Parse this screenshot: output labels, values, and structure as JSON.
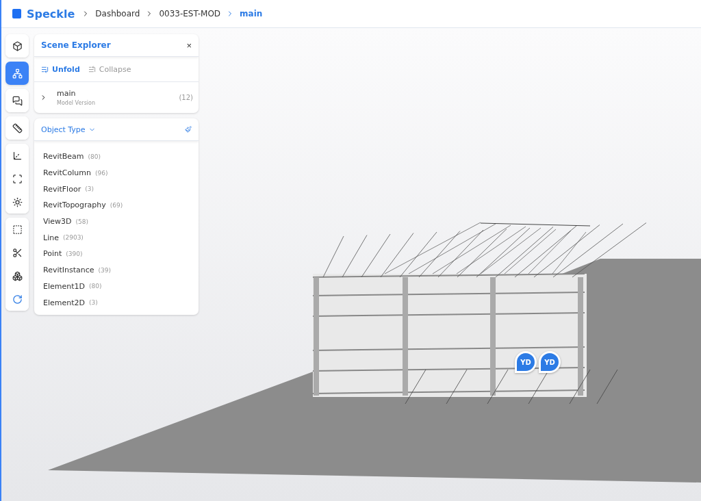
{
  "header": {
    "brand": "Speckle",
    "breadcrumbs": [
      {
        "label": "Dashboard",
        "current": false
      },
      {
        "label": "0033-EST-MOD",
        "current": false
      },
      {
        "label": "main",
        "current": true
      }
    ]
  },
  "toolbar": {
    "groups": [
      {
        "tools": [
          {
            "selected": false
          }
        ]
      },
      {
        "tools": [
          {
            "selected": true
          }
        ]
      },
      {
        "tools": [
          {
            "selected": false
          }
        ]
      },
      {
        "tools": [
          {
            "selected": false
          }
        ]
      },
      {
        "tools": [
          {
            "selected": false
          },
          {
            "selected": false
          },
          {
            "selected": false
          }
        ]
      },
      {
        "tools": [
          {
            "selected": false
          },
          {
            "selected": false
          },
          {
            "selected": false
          },
          {
            "selected": false
          }
        ]
      }
    ]
  },
  "scene_explorer": {
    "title": "Scene Explorer",
    "close": "×",
    "actions": [
      {
        "label": "Unfold",
        "disabled": false
      },
      {
        "label": "Collapse",
        "disabled": true
      }
    ],
    "model": {
      "name": "main",
      "subtitle": "Model Version",
      "count": "(12)",
      "expanded": false
    }
  },
  "filter": {
    "title": "Object Type",
    "items": [
      {
        "name": "RevitBeam",
        "count": "(80)"
      },
      {
        "name": "RevitColumn",
        "count": "(96)"
      },
      {
        "name": "RevitFloor",
        "count": "(3)"
      },
      {
        "name": "RevitTopography",
        "count": "(69)"
      },
      {
        "name": "View3D",
        "count": "(58)"
      },
      {
        "name": "Line",
        "count": "(2903)"
      },
      {
        "name": "Point",
        "count": "(390)"
      },
      {
        "name": "RevitInstance",
        "count": "(39)"
      },
      {
        "name": "Element1D",
        "count": "(80)"
      },
      {
        "name": "Element2D",
        "count": "(3)"
      }
    ]
  },
  "viewer": {
    "markers": [
      {
        "initials": "YD"
      },
      {
        "initials": "YD"
      }
    ]
  }
}
